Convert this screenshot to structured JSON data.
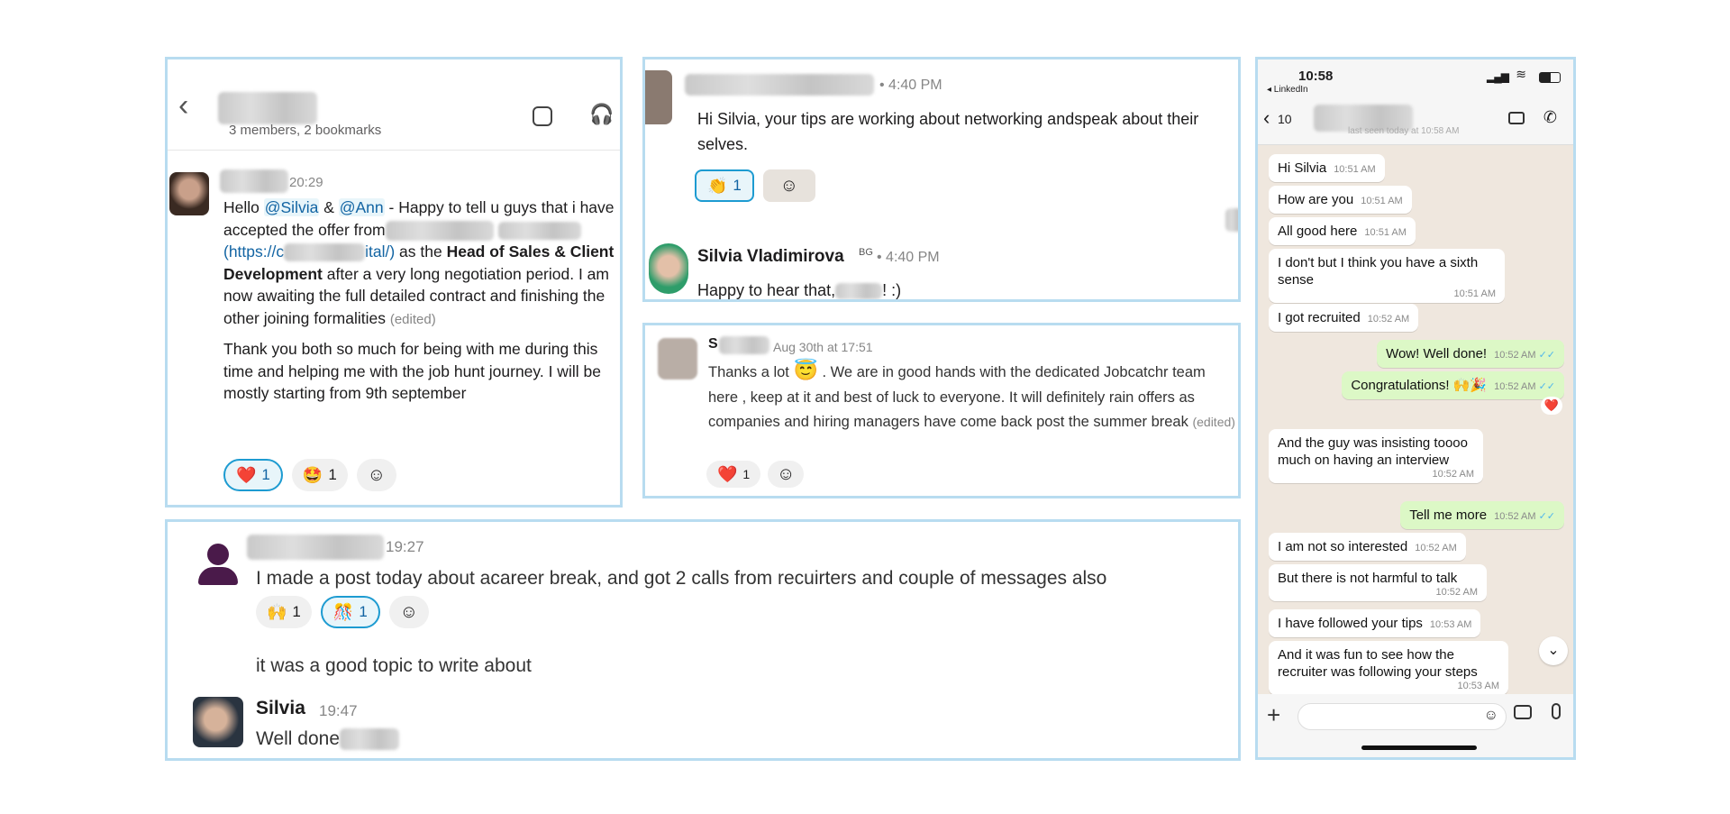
{
  "colors": {
    "accent": "#1264a3",
    "panel_border": "#b8dcf0",
    "wa_out": "#dcf8c6",
    "wa_bg": "#efe7de"
  },
  "panel1": {
    "header_sub": "3 members, 2 bookmarks",
    "msg": {
      "time": "20:29",
      "hello": "Hello ",
      "mention1": "@Silvia",
      "amp": " & ",
      "mention2": "@Ann",
      "p1a": " - Happy to tell u guys that i have accepted the offer from",
      "link_open": "(https://c",
      "link_close": "ital/)",
      "p1b": " as the ",
      "role": "Head of Sales & Client Development",
      "p1c": " after a very long negotiation period. I am now awaiting the full detailed contract and finishing the other joining formalities",
      "edited": "(edited)",
      "p2": "Thank you both so much for being with me during this time and helping me with the job hunt journey. I will be mostly starting from 9th september"
    },
    "reactions": [
      {
        "emoji": "❤️",
        "count": "1"
      },
      {
        "emoji": "🤩",
        "count": "1"
      }
    ]
  },
  "panel2": {
    "time1": "• 4:40 PM",
    "text1": "Hi Silvia, your tips are working about networking andspeak about their selves.",
    "reaction": {
      "emoji": "👏",
      "count": "1"
    },
    "name2": "Silvia Vladimirova",
    "badge": "BG",
    "time2": "• 4:40 PM",
    "text2a": "Happy to hear that,",
    "text2b": "! :)"
  },
  "panel3": {
    "initial": "S",
    "time": "Aug 30th at 17:51",
    "text_a": "Thanks a lot",
    "emoji": "😇",
    "text_b": ". We are in good hands with the dedicated Jobcatchr team here , keep at it and best of luck to everyone. It will definitely rain offers as companies and hiring managers have come back post the summer break",
    "edited": "(edited)",
    "reaction": {
      "emoji": "❤️",
      "count": "1"
    }
  },
  "panel4": {
    "time1": "19:27",
    "text1": "I made a post today about acareer break, and got 2 calls from recuirters and couple of messages also",
    "reactions": [
      {
        "emoji": "🙌",
        "count": "1"
      },
      {
        "emoji": "🎊",
        "count": "1"
      }
    ],
    "text2": "it was a good topic to write about",
    "name2": "Silvia",
    "time2": "19:47",
    "text3": "Well done"
  },
  "whatsapp": {
    "clock": "10:58",
    "back_app": "◂ LinkedIn",
    "back_count": "10",
    "last_seen": "last seen today at 10:58 AM",
    "messages": [
      {
        "text": "Hi Silvia",
        "time": "10:51 AM",
        "out": false
      },
      {
        "text": "How are you",
        "time": "10:51 AM",
        "out": false
      },
      {
        "text": "All good here",
        "time": "10:51 AM",
        "out": false
      },
      {
        "text": "I don't but I think you have a sixth sense",
        "time": "10:51 AM",
        "out": false
      },
      {
        "text": "I got recruited",
        "time": "10:52 AM",
        "out": false
      },
      {
        "text": "Wow! Well done!",
        "time": "10:52 AM",
        "out": true
      },
      {
        "text": "Congratulations! 🙌🎉",
        "time": "10:52 AM",
        "out": true
      },
      {
        "text": "And the guy was insisting toooo much on having an interview",
        "time": "10:52 AM",
        "out": false
      },
      {
        "text": "Tell me more",
        "time": "10:52 AM",
        "out": true
      },
      {
        "text": "I am not so interested",
        "time": "10:52 AM",
        "out": false
      },
      {
        "text": "But there is not harmful to talk",
        "time": "10:52 AM",
        "out": false
      },
      {
        "text": "I have followed your tips",
        "time": "10:53 AM",
        "out": false
      },
      {
        "text": "And it was fun to see how the recruiter was following your steps",
        "time": "10:53 AM",
        "out": false
      }
    ],
    "heart": "❤️"
  }
}
